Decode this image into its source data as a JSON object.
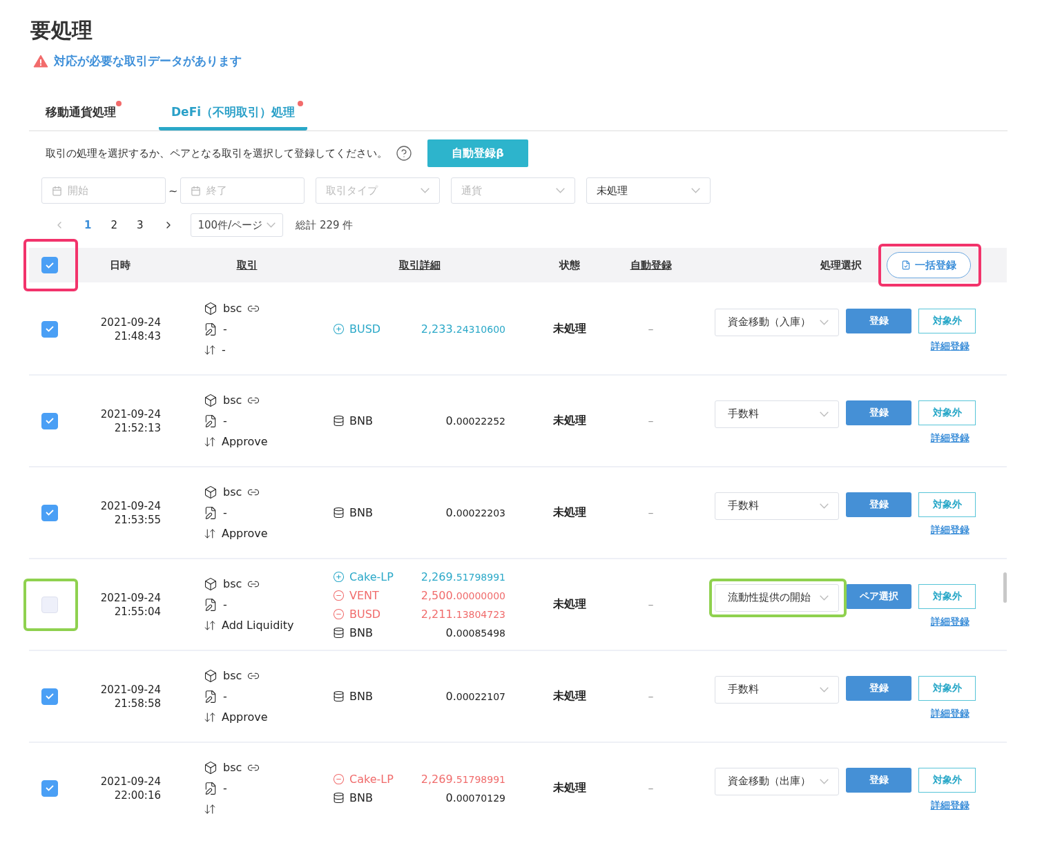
{
  "page_title": "要処理",
  "alert": "対応が必要な取引データがあります",
  "tabs": [
    {
      "label": "移動通貨処理",
      "selected": false,
      "badge": true
    },
    {
      "label": "DeFi（不明取引）処理",
      "selected": true,
      "badge": true
    }
  ],
  "instruction": "取引の処理を選択するか、ペアとなる取引を選択して登録してください。",
  "auto_button": "自動登録β",
  "filters": {
    "start": {
      "placeholder": "開始"
    },
    "range_separator": "~",
    "end": {
      "placeholder": "終了"
    },
    "type": {
      "placeholder": "取引タイプ"
    },
    "currency": {
      "placeholder": "通貨"
    },
    "status": {
      "value": "未処理"
    }
  },
  "pagination": {
    "pages": [
      {
        "label": "1",
        "selected": true
      },
      {
        "label": "2",
        "selected": false
      },
      {
        "label": "3",
        "selected": false
      }
    ],
    "page_size": "100件/ページ",
    "total": "総計 229 件"
  },
  "table": {
    "select_all": {
      "checked": true,
      "highlight": {
        "color": "#f2336b"
      }
    },
    "columns": [
      {
        "label": "日時",
        "underlined": false
      },
      {
        "label": "取引",
        "underlined": true
      },
      {
        "label": "取引詳細",
        "underlined": true
      },
      {
        "label": "状態",
        "underlined": false
      },
      {
        "label": "自動登録",
        "underlined": true
      },
      {
        "label": "処理選択",
        "underlined": false
      }
    ],
    "bulk_button": {
      "label": "一括登録",
      "highlight": {
        "color": "#f2336b"
      }
    },
    "rows": [
      {
        "checked": true,
        "date": "2021-09-24",
        "time": "21:48:43",
        "chain": "bsc",
        "memo": "-",
        "type": "-",
        "details": [
          {
            "kind": "in",
            "currency": "BUSD",
            "amount": "2,233.24310600"
          }
        ],
        "status": "未処理",
        "auto": "–",
        "action": {
          "value": "資金移動（入庫）"
        },
        "primary": "登録",
        "exclude": "対象外",
        "detail_link": "詳細登録"
      },
      {
        "checked": true,
        "date": "2021-09-24",
        "time": "21:52:13",
        "chain": "bsc",
        "memo": "-",
        "type": "Approve",
        "details": [
          {
            "kind": "fee",
            "currency": "BNB",
            "amount": "0.00022252"
          }
        ],
        "status": "未処理",
        "auto": "–",
        "action": {
          "value": "手数料"
        },
        "primary": "登録",
        "exclude": "対象外",
        "detail_link": "詳細登録"
      },
      {
        "checked": true,
        "date": "2021-09-24",
        "time": "21:53:55",
        "chain": "bsc",
        "memo": "-",
        "type": "Approve",
        "details": [
          {
            "kind": "fee",
            "currency": "BNB",
            "amount": "0.00022203"
          }
        ],
        "status": "未処理",
        "auto": "–",
        "action": {
          "value": "手数料"
        },
        "primary": "登録",
        "exclude": "対象外",
        "detail_link": "詳細登録"
      },
      {
        "checked": false,
        "highlight": {
          "color": "#8fd14f"
        },
        "date": "2021-09-24",
        "time": "21:55:04",
        "chain": "bsc",
        "memo": "-",
        "type": "Add Liquidity",
        "details": [
          {
            "kind": "in",
            "currency": "Cake-LP",
            "amount": "2,269.51798991"
          },
          {
            "kind": "out",
            "currency": "VENT",
            "amount": "2,500.00000000"
          },
          {
            "kind": "out",
            "currency": "BUSD",
            "amount": "2,211.13804723"
          },
          {
            "kind": "fee",
            "currency": "BNB",
            "amount": "0.00085498"
          }
        ],
        "status": "未処理",
        "auto": "–",
        "action": {
          "value": "流動性提供の開始",
          "highlight": {
            "color": "#8fd14f"
          }
        },
        "primary": "ペア選択",
        "exclude": "対象外",
        "detail_link": "詳細登録"
      },
      {
        "checked": true,
        "date": "2021-09-24",
        "time": "21:58:58",
        "chain": "bsc",
        "memo": "-",
        "type": "Approve",
        "details": [
          {
            "kind": "fee",
            "currency": "BNB",
            "amount": "0.00022107"
          }
        ],
        "status": "未処理",
        "auto": "–",
        "action": {
          "value": "手数料"
        },
        "primary": "登録",
        "exclude": "対象外",
        "detail_link": "詳細登録"
      },
      {
        "checked": true,
        "date": "2021-09-24",
        "time": "22:00:16",
        "chain": "bsc",
        "memo": "-",
        "details": [
          {
            "kind": "out",
            "currency": "Cake-LP",
            "amount": "2,269.51798991"
          },
          {
            "kind": "fee",
            "currency": "BNB",
            "amount": "0.00070129"
          }
        ],
        "status": "未処理",
        "auto": "–",
        "action": {
          "value": "資金移動（出庫）"
        },
        "primary": "登録",
        "exclude": "対象外",
        "detail_link": "詳細登録"
      }
    ]
  }
}
